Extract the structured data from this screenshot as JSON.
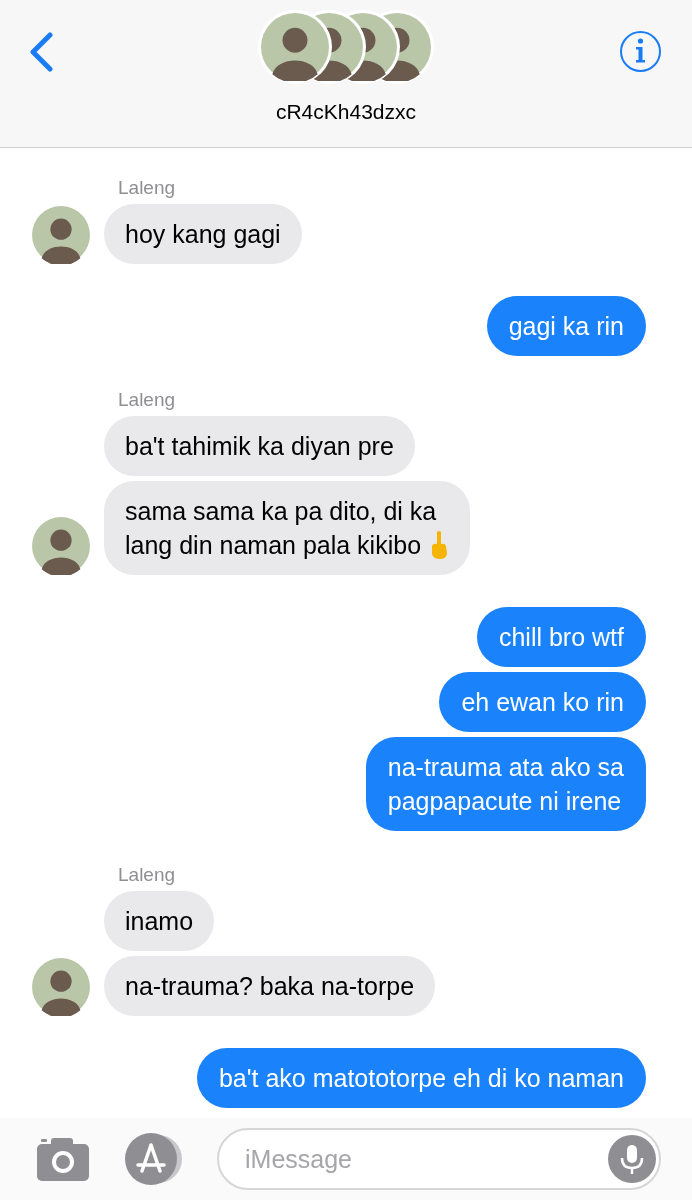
{
  "header": {
    "title": "cR4cKh43dzxc"
  },
  "messages": [
    {
      "kind": "incoming",
      "sender": "Laleng",
      "bubbles": [
        {
          "lines": [
            "hoy kang gagi"
          ]
        }
      ]
    },
    {
      "kind": "outgoing",
      "bubbles": [
        {
          "lines": [
            "gagi ka rin"
          ]
        }
      ]
    },
    {
      "kind": "incoming",
      "sender": "Laleng",
      "bubbles": [
        {
          "lines": [
            "ba't tahimik ka diyan pre"
          ]
        },
        {
          "kind": "with-hand",
          "lines": [
            "sama sama ka pa dito, di ka",
            "lang din naman pala kikibo"
          ]
        }
      ]
    },
    {
      "kind": "outgoing",
      "bubbles": [
        {
          "lines": [
            "chill bro wtf"
          ]
        },
        {
          "lines": [
            "eh ewan ko rin"
          ]
        },
        {
          "lines": [
            "na-trauma ata ako sa",
            "pagpapacute ni irene"
          ]
        }
      ]
    },
    {
      "kind": "incoming",
      "sender": "Laleng",
      "bubbles": [
        {
          "lines": [
            "inamo"
          ]
        },
        {
          "lines": [
            "na-trauma? baka na-torpe"
          ]
        }
      ]
    },
    {
      "kind": "outgoing",
      "bubbles": [
        {
          "lines": [
            "ba't ako matototorpe eh di ko naman"
          ]
        }
      ]
    }
  ],
  "input": {
    "placeholder": "iMessage"
  }
}
